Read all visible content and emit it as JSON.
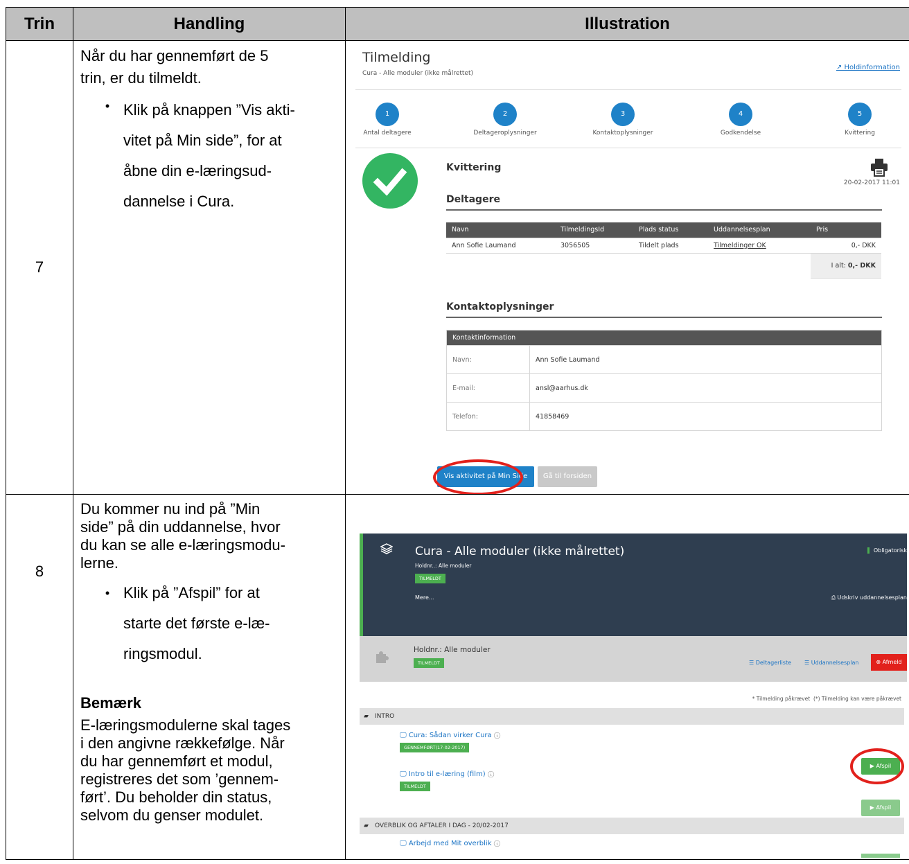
{
  "table": {
    "headers": [
      "Trin",
      "Handling",
      "Illustration"
    ]
  },
  "row7": {
    "trin": "7",
    "intro1": "Når du har gennemført de 5",
    "intro2": "trin, er du tilmeldt.",
    "bullet": "•",
    "b1": "Klik på knappen ”Vis akti-",
    "b2": "vitet på Min side”, for at",
    "b3": "åbne din e-læringsud-",
    "b4": "dannelse i Cura."
  },
  "row8": {
    "trin": "8",
    "p1": "Du kommer nu ind på ”Min",
    "p2": "side” på din uddannelse, hvor",
    "p3": "du kan se alle e-læringsmodu-",
    "p4": "lerne.",
    "bullet": "•",
    "b1": "Klik på ”Afspil” for at",
    "b2": "starte det første e-læ-",
    "b3": "ringsmodul.",
    "note_title": "Bemærk",
    "n1": "E-læringsmodulerne skal tages",
    "n2": "i den angivne rækkefølge. Når",
    "n3": "du har gennemført et modul,",
    "n4": "registreres det som ’gennem-",
    "n5": "ført’. Du beholder din status,",
    "n6": "selvom du genser modulet."
  },
  "shot1": {
    "title": "Tilmelding",
    "subtitle": "Cura - Alle moduler (ikke målrettet)",
    "holdinfo": "Holdinformation",
    "steps": [
      {
        "n": "1",
        "label": "Antal deltagere"
      },
      {
        "n": "2",
        "label": "Deltageroplysninger"
      },
      {
        "n": "3",
        "label": "Kontaktoplysninger"
      },
      {
        "n": "4",
        "label": "Godkendelse"
      },
      {
        "n": "5",
        "label": "Kvittering"
      }
    ],
    "kvittering": "Kvittering",
    "date": "20-02-2017 11:01",
    "deltagere": "Deltagere",
    "cols": [
      "Navn",
      "TilmeldingsId",
      "Plads status",
      "Uddannelsesplan",
      "Pris"
    ],
    "row": [
      "Ann Sofie Laumand",
      "3056505",
      "Tildelt plads",
      "Tilmeldinger OK",
      "0,- DKK"
    ],
    "total_label": "I alt:",
    "total_value": "0,- DKK",
    "kontakt_title": "Kontaktoplysninger",
    "kontakt_header": "Kontaktinformation",
    "kontakt": [
      {
        "k": "Navn:",
        "v": "Ann Sofie Laumand"
      },
      {
        "k": "E-mail:",
        "v": "ansl@aarhus.dk"
      },
      {
        "k": "Telefon:",
        "v": "41858469"
      }
    ],
    "btn_primary": "Vis aktivitet på Min Side",
    "btn_secondary": "Gå til forsiden",
    "colors": {
      "blue": "#1f82c8",
      "green": "#33b562",
      "red": "#e2211c"
    }
  },
  "shot2": {
    "course": "Cura - Alle moduler (ikke målrettet)",
    "holdnr": "Holdnr..: Alle moduler",
    "tag": "TILMELDT",
    "mere": "Mere...",
    "obligatorisk": "Obligatorisk",
    "udskriv": "Udskriv uddannelsesplan",
    "holdnr2": "Holdnr.: Alle moduler",
    "deltagerliste": "Deltagerliste",
    "uddannelsesplan": "Uddannelsesplan",
    "afmeld": "Afmeld",
    "legend1": "* Tilmelding påkrævet",
    "legend2": "(*) Tilmelding kan være påkrævet",
    "intro": "INTRO",
    "m1": "Cura: Sådan virker Cura",
    "m1tag": "GENNEMFØRT(17-02-2017)",
    "afspil": "Afspil",
    "m2": "Intro til e-læring (film)",
    "m2tag": "TILMELDT",
    "overblik": "OVERBLIK OG AFTALER I DAG - 20/02-2017",
    "m3": "Arbejd med Mit overblik",
    "colors": {
      "dark": "#2f3e50",
      "green": "#4caf50",
      "red": "#e2211c"
    }
  }
}
